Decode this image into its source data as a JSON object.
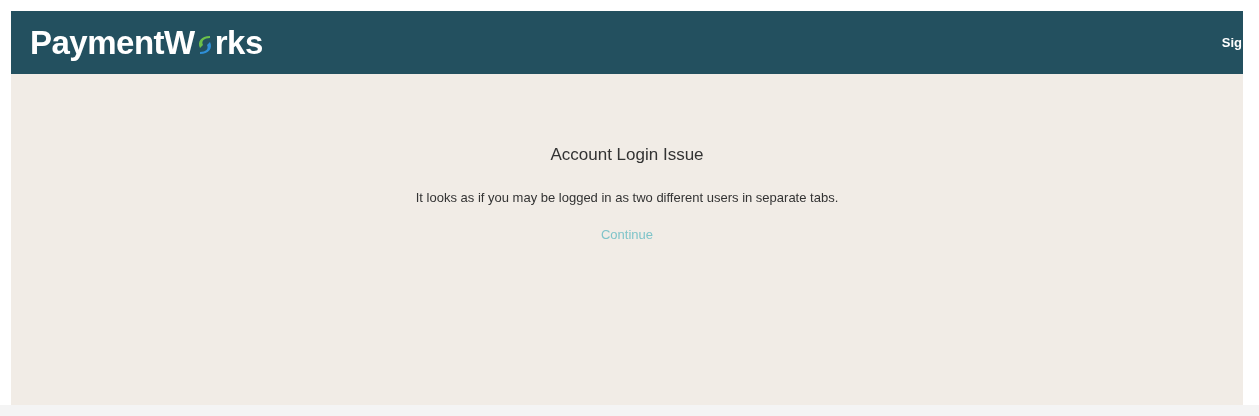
{
  "header": {
    "logo": {
      "before": "PaymentW",
      "after": "rks"
    },
    "sign_link": "Sig"
  },
  "message": {
    "title": "Account Login Issue",
    "body": "It looks as if you may be logged in as two different users in separate tabs.",
    "button": {
      "label": "Continue",
      "disabled": true
    }
  }
}
